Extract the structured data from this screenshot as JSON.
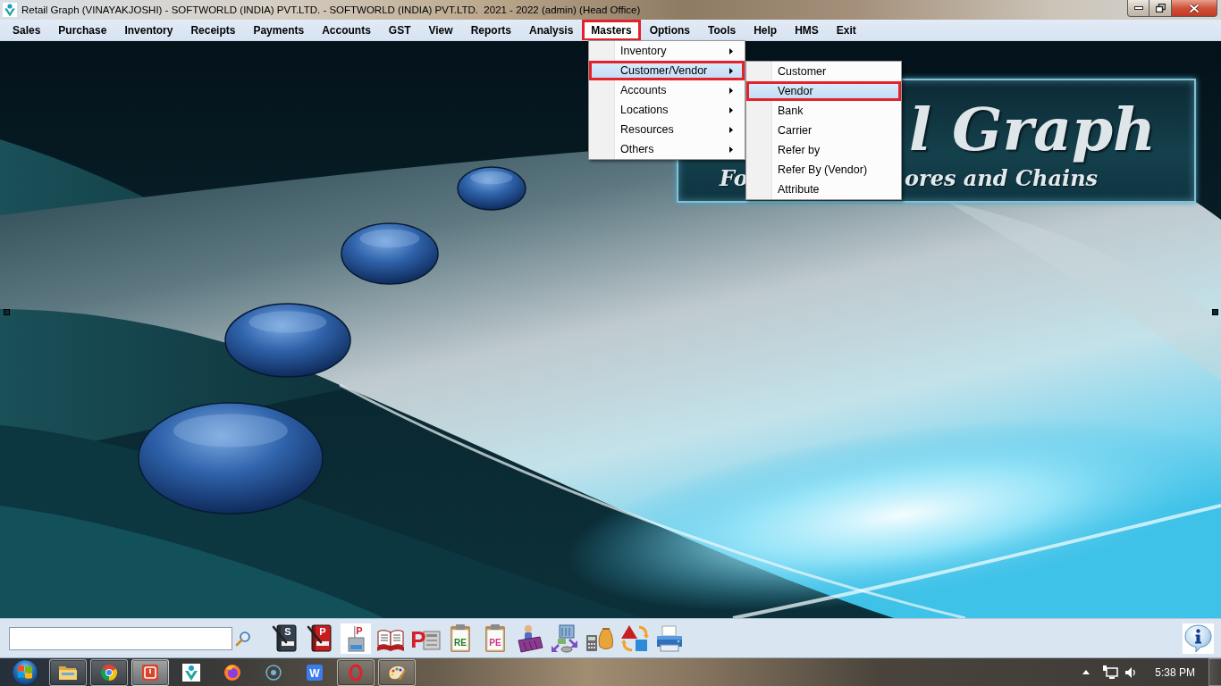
{
  "window": {
    "title": "Retail Graph (VINAYAKJOSHI) - SOFTWORLD (INDIA) PVT.LTD. - SOFTWORLD (INDIA) PVT.LTD.  2021 - 2022 (admin) (Head Office)"
  },
  "menu_bar": [
    {
      "label": "Sales",
      "selected": false,
      "marked": false
    },
    {
      "label": "Purchase",
      "selected": false,
      "marked": false
    },
    {
      "label": "Inventory",
      "selected": false,
      "marked": false
    },
    {
      "label": "Receipts",
      "selected": false,
      "marked": false
    },
    {
      "label": "Payments",
      "selected": false,
      "marked": false
    },
    {
      "label": "Accounts",
      "selected": false,
      "marked": false
    },
    {
      "label": "GST",
      "selected": false,
      "marked": false
    },
    {
      "label": "View",
      "selected": false,
      "marked": false
    },
    {
      "label": "Reports",
      "selected": false,
      "marked": false
    },
    {
      "label": "Analysis",
      "selected": false,
      "marked": false
    },
    {
      "label": "Masters",
      "selected": true,
      "marked": true
    },
    {
      "label": "Options",
      "selected": false,
      "marked": false
    },
    {
      "label": "Tools",
      "selected": false,
      "marked": false
    },
    {
      "label": "Help",
      "selected": false,
      "marked": false
    },
    {
      "label": "HMS",
      "selected": false,
      "marked": false
    },
    {
      "label": "Exit",
      "selected": false,
      "marked": false
    }
  ],
  "masters_menu": [
    {
      "label": "Inventory",
      "submenu": true,
      "selected": false,
      "marked": false
    },
    {
      "label": "Customer/Vendor",
      "submenu": true,
      "selected": true,
      "marked": true
    },
    {
      "label": "Accounts",
      "submenu": true,
      "selected": false,
      "marked": false
    },
    {
      "label": "Locations",
      "submenu": true,
      "selected": false,
      "marked": false
    },
    {
      "label": "Resources",
      "submenu": true,
      "selected": false,
      "marked": false
    },
    {
      "label": "Others",
      "submenu": true,
      "selected": false,
      "marked": false
    }
  ],
  "customer_vendor_menu": [
    {
      "label": "Customer",
      "submenu": false,
      "selected": false,
      "marked": false
    },
    {
      "label": "Vendor",
      "submenu": false,
      "selected": true,
      "marked": true
    },
    {
      "label": "Bank",
      "submenu": false,
      "selected": false,
      "marked": false
    },
    {
      "label": "Carrier",
      "submenu": false,
      "selected": false,
      "marked": false
    },
    {
      "label": "Refer by",
      "submenu": false,
      "selected": false,
      "marked": false
    },
    {
      "label": "Refer By (Vendor)",
      "submenu": false,
      "selected": false,
      "marked": false
    },
    {
      "label": "Attribute",
      "submenu": false,
      "selected": false,
      "marked": false
    }
  ],
  "wallpaper": {
    "logo": {
      "title": "l Graph",
      "tagline_left": "Fo",
      "tagline_right": "ores and Chains"
    }
  },
  "toolbar": {
    "icons": [
      {
        "kind": "slatebook",
        "letters": "S"
      },
      {
        "kind": "redbook",
        "letters": "P"
      },
      {
        "kind": "ballot",
        "letters": "P"
      },
      {
        "kind": "openbook"
      },
      {
        "kind": "press",
        "letters": "P"
      },
      {
        "kind": "greenclip",
        "letters": "RE"
      },
      {
        "kind": "pinkclip",
        "letters": "PE"
      },
      {
        "kind": "porter"
      },
      {
        "kind": "exchange"
      },
      {
        "kind": "moneybag"
      },
      {
        "kind": "shapes"
      },
      {
        "kind": "printer"
      }
    ]
  },
  "taskbar": {
    "apps": [
      {
        "kind": "folder",
        "running": true,
        "active": false
      },
      {
        "kind": "sphere",
        "running": true,
        "active": false
      },
      {
        "kind": "powertile",
        "running": true,
        "active": true
      },
      {
        "kind": "figure",
        "running": false,
        "active": false
      },
      {
        "kind": "flame",
        "running": false,
        "active": false
      },
      {
        "kind": "target",
        "running": false,
        "active": false
      },
      {
        "kind": "lettertile",
        "letters": "W",
        "running": false,
        "active": false
      },
      {
        "kind": "ring",
        "running": true,
        "active": false
      },
      {
        "kind": "palette",
        "running": true,
        "active": false
      }
    ],
    "clock": "5:38 PM"
  }
}
